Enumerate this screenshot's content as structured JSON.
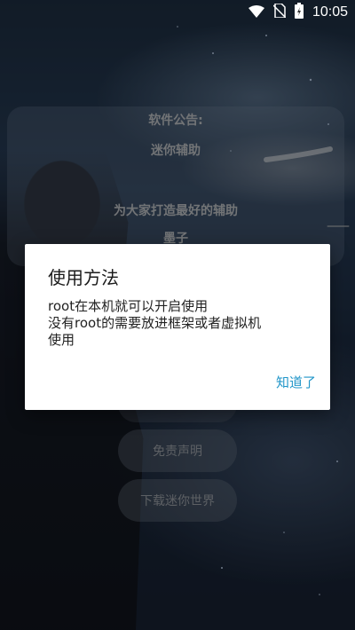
{
  "status_bar": {
    "time": "10:05",
    "icons": [
      "wifi-icon",
      "no-sim-icon",
      "battery-charging-icon"
    ]
  },
  "notice": {
    "heading": "软件公告:",
    "app_name": "迷你辅助",
    "slogan": "为大家打造最好的辅助",
    "author": "墨子",
    "dash": "——"
  },
  "menu": {
    "disclaimer": "免责声明",
    "download": "下载迷你世界"
  },
  "dialog": {
    "title": "使用方法",
    "message_lines": [
      "root在本机就可以开启使用",
      "没有root的需要放进框架或者虚拟机",
      "使用"
    ],
    "confirm": "知道了"
  },
  "colors": {
    "dialog_button": "#2196c9"
  }
}
